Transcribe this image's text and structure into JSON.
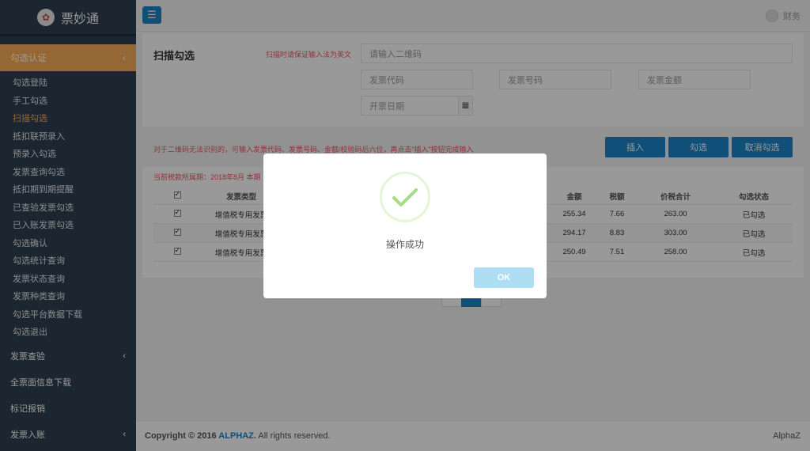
{
  "brand": {
    "name": "票妙通",
    "logo_icon": "flower-logo-icon"
  },
  "sidebar": {
    "active_group": "勾选认证",
    "sub_items": [
      {
        "label": "勾选登陆"
      },
      {
        "label": "手工勾选"
      },
      {
        "label": "扫描勾选"
      },
      {
        "label": "抵扣联预录入"
      },
      {
        "label": "预录入勾选"
      },
      {
        "label": "发票查询勾选"
      },
      {
        "label": "抵扣期到期提醒"
      },
      {
        "label": "已查验发票勾选"
      },
      {
        "label": "已入账发票勾选"
      },
      {
        "label": "勾选确认"
      },
      {
        "label": "勾选统计查询"
      },
      {
        "label": "发票状态查询"
      },
      {
        "label": "发票种类查询"
      },
      {
        "label": "勾选平台数据下载"
      },
      {
        "label": "勾选退出"
      }
    ],
    "groups": [
      {
        "label": "发票查验",
        "chevron": "‹"
      },
      {
        "label": "全票面信息下载",
        "chevron": ""
      },
      {
        "label": "标记报销",
        "chevron": ""
      },
      {
        "label": "发票入账",
        "chevron": "‹"
      }
    ],
    "chevron": "‹"
  },
  "topbar": {
    "menu_icon": "☰",
    "user_name": "财务"
  },
  "scan": {
    "title": "扫描勾选",
    "hint": "扫描时请保证输入法为英文",
    "qr_placeholder": "请输入二维码",
    "code_placeholder": "发票代码",
    "number_placeholder": "发票号码",
    "amount_placeholder": "发票金额",
    "date_placeholder": "开票日期"
  },
  "actions": {
    "info": "对于二维码无法识别的，可输入发票代码、发票号码、金额/校验码后六位，再点击“插入”按钮完成输入",
    "insert": "插入",
    "select": "勾选",
    "cancel": "取消勾选"
  },
  "table": {
    "period": "当前税款所属期：2018年8月 本期",
    "headers": {
      "type": "发票类型",
      "amount": "金额",
      "tax": "税额",
      "total": "价税合计",
      "state": "勾选状态"
    },
    "rows": [
      {
        "type": "增值税专用发票",
        "amount": "255.34",
        "tax": "7.66",
        "total": "263.00",
        "state": "已勾选"
      },
      {
        "type": "增值税专用发票",
        "amount": "294.17",
        "tax": "8.83",
        "total": "303.00",
        "state": "已勾选"
      },
      {
        "type": "增值税专用发票",
        "amount": "250.49",
        "tax": "7.51",
        "total": "258.00",
        "state": "已勾选"
      }
    ]
  },
  "footer": {
    "copyright": "Copyright © 2016 ",
    "company": "ALPHAZ.",
    "rights": " All rights reserved.",
    "right": "AlphaZ"
  },
  "dialog": {
    "message": "操作成功",
    "ok": "OK",
    "icon": "success-check-icon",
    "accent": "#a5dc86"
  },
  "colors": {
    "sidebar": "#2f4050",
    "active": "#f8ac59",
    "primary": "#1c84c6",
    "danger": "#ed5565"
  }
}
